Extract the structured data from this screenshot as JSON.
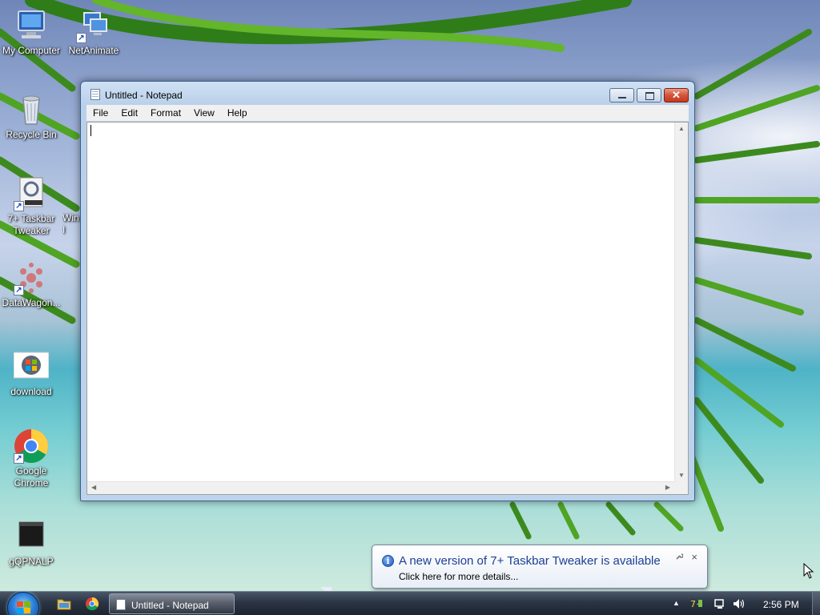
{
  "desktop": {
    "icons": [
      {
        "label": "My Computer"
      },
      {
        "label": "NetAnimate"
      },
      {
        "label": "Recycle Bin"
      },
      {
        "label": "7+ Taskbar Tweaker"
      },
      {
        "label": "Win I"
      },
      {
        "label": "DataWagon..."
      },
      {
        "label": "download"
      },
      {
        "label": "Google Chrome"
      },
      {
        "label": "gQPNALP"
      }
    ]
  },
  "window": {
    "title": "Untitled - Notepad",
    "menu": [
      "File",
      "Edit",
      "Format",
      "View",
      "Help"
    ],
    "text_content": ""
  },
  "notification": {
    "title": "A new version of 7+ Taskbar Tweaker is available",
    "body": "Click here for more details...",
    "close_glyph": "×"
  },
  "taskbar": {
    "task_label": "Untitled - Notepad",
    "clock": "2:56 PM",
    "tray_icons": [
      "show-hidden-icons",
      "taskbar-tweaker-icon",
      "network-icon",
      "volume-icon"
    ]
  },
  "colors": {
    "balloon_title": "#1c3f94",
    "close_button": "#c23a20",
    "taskbar": "#2b3444"
  }
}
